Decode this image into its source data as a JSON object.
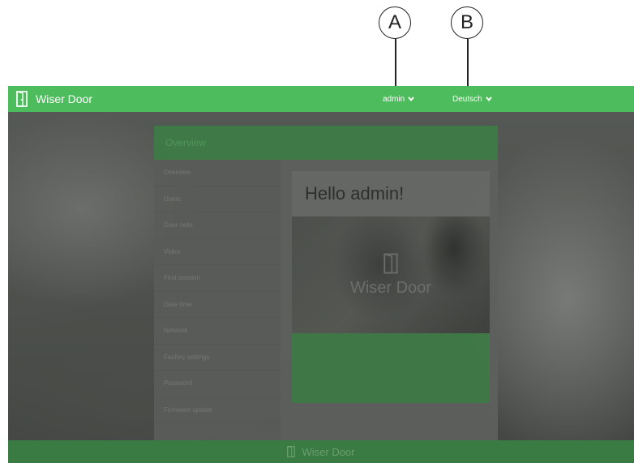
{
  "callouts": {
    "a": "A",
    "b": "B"
  },
  "topbar": {
    "brand": "Wiser Door",
    "user_label": "admin",
    "language_label": "Deutsch"
  },
  "modal": {
    "header": "Overview",
    "nav": [
      "Overview",
      "Users",
      "Door cells",
      "Video",
      "First session",
      "Date time",
      "Network",
      "Factory settings",
      "Password",
      "Firmware update"
    ],
    "greeting": "Hello admin!",
    "hero_label": "Wiser Door"
  },
  "footer": {
    "brand": "Wiser Door"
  },
  "colors": {
    "accent": "#4cbc5c",
    "dim_green": "#3a7a43"
  },
  "icons": {
    "brand": "door-icon",
    "chevron": "chevron-down-icon"
  }
}
